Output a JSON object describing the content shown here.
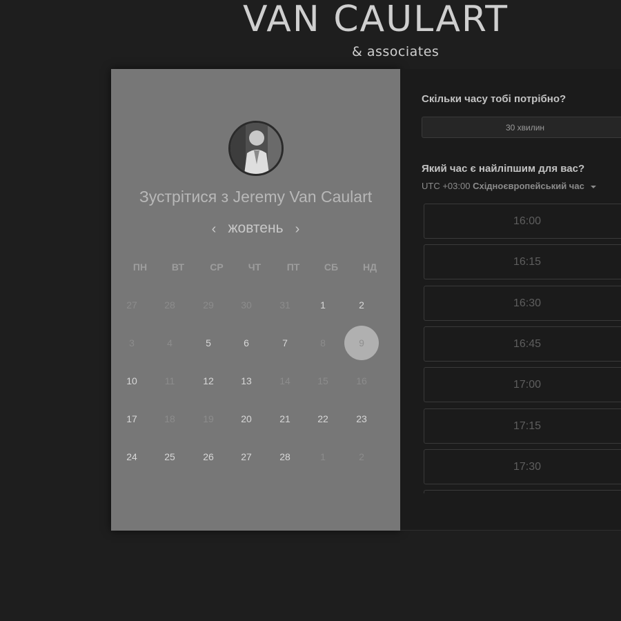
{
  "brand": {
    "title": "VAN CAULART",
    "subtitle": "& associates"
  },
  "booking": {
    "meet_title": "Зустрітися з Jeremy Van Caulart",
    "month": "жовтень",
    "prev_icon": "chevron-left-icon",
    "next_icon": "chevron-right-icon",
    "weekdays": [
      "ПН",
      "ВТ",
      "СР",
      "ЧТ",
      "ПТ",
      "СБ",
      "НД"
    ],
    "days": [
      {
        "label": "27",
        "available": false
      },
      {
        "label": "28",
        "available": false
      },
      {
        "label": "29",
        "available": false
      },
      {
        "label": "30",
        "available": false
      },
      {
        "label": "31",
        "available": false
      },
      {
        "label": "1",
        "available": true
      },
      {
        "label": "2",
        "available": true
      },
      {
        "label": "3",
        "available": false
      },
      {
        "label": "4",
        "available": false
      },
      {
        "label": "5",
        "available": true
      },
      {
        "label": "6",
        "available": true
      },
      {
        "label": "7",
        "available": true
      },
      {
        "label": "8",
        "available": false
      },
      {
        "label": "9",
        "available": true,
        "selected": true
      },
      {
        "label": "10",
        "available": true
      },
      {
        "label": "11",
        "available": false
      },
      {
        "label": "12",
        "available": true
      },
      {
        "label": "13",
        "available": true
      },
      {
        "label": "14",
        "available": false
      },
      {
        "label": "15",
        "available": false
      },
      {
        "label": "16",
        "available": false
      },
      {
        "label": "17",
        "available": true
      },
      {
        "label": "18",
        "available": false
      },
      {
        "label": "19",
        "available": false
      },
      {
        "label": "20",
        "available": true
      },
      {
        "label": "21",
        "available": true
      },
      {
        "label": "22",
        "available": true
      },
      {
        "label": "23",
        "available": true
      },
      {
        "label": "24",
        "available": true
      },
      {
        "label": "25",
        "available": true
      },
      {
        "label": "26",
        "available": true
      },
      {
        "label": "27",
        "available": true
      },
      {
        "label": "28",
        "available": true
      },
      {
        "label": "1",
        "available": false
      },
      {
        "label": "2",
        "available": false
      }
    ]
  },
  "schedule": {
    "duration_question": "Скільки часу тобі потрібно?",
    "duration_value": "30 хвилин",
    "time_question": "Який час є найліпшим для вас?",
    "timezone_offset": "UTC +03:00",
    "timezone_name": "Східноєвропейський час",
    "slots": [
      "16:00",
      "16:15",
      "16:30",
      "16:45",
      "17:00",
      "17:15",
      "17:30"
    ]
  },
  "colors": {
    "page_bg": "#1e1e1e",
    "calendar_bg": "#777777",
    "selected_day": "#b0b0b0"
  }
}
